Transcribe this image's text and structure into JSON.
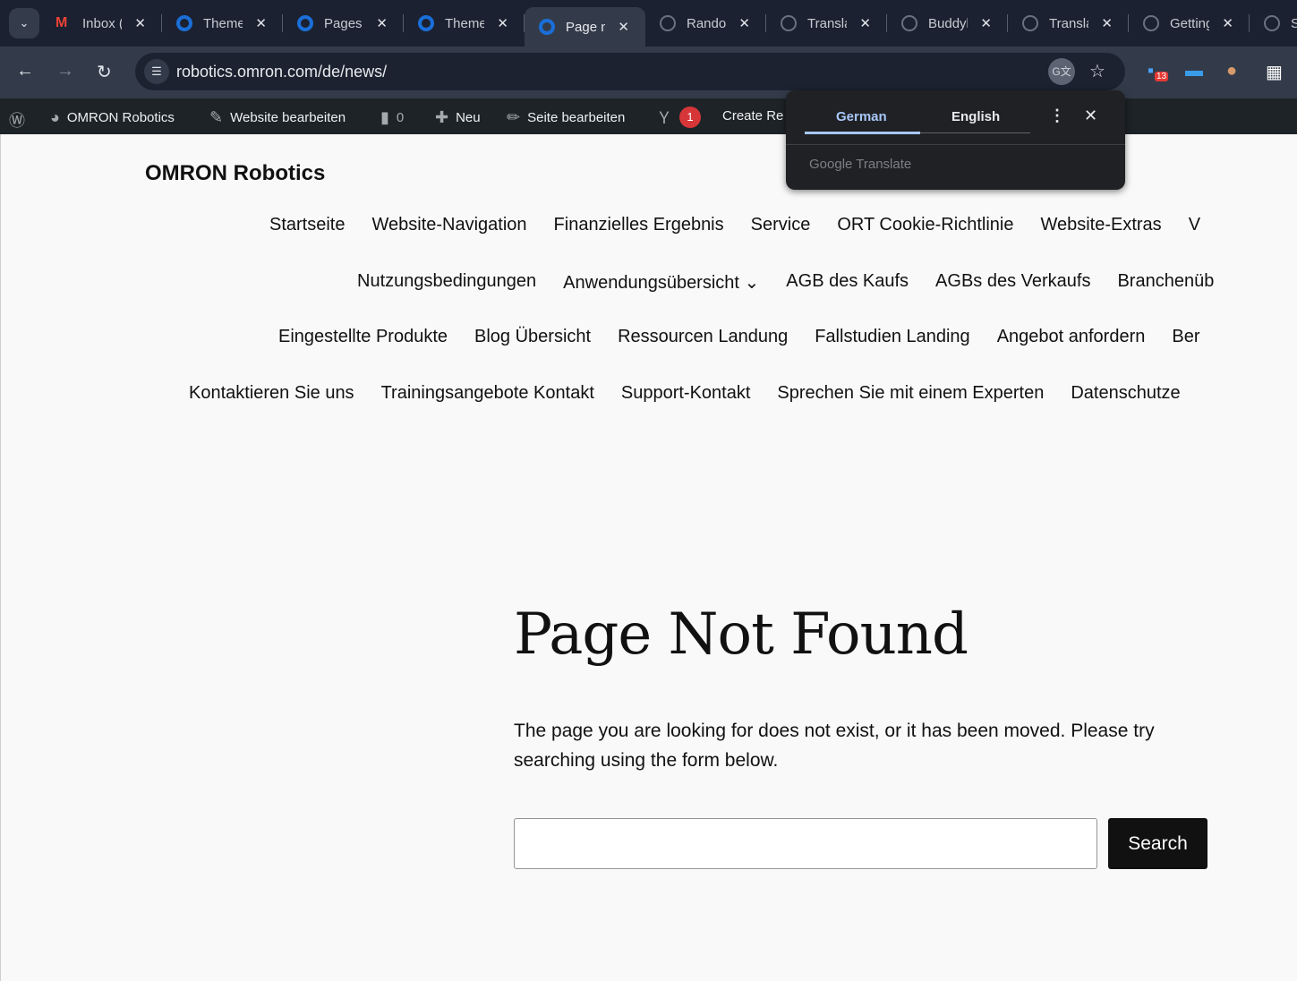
{
  "tabs": [
    {
      "title": "Inbox (",
      "icon": "gmail"
    },
    {
      "title": "Theme",
      "icon": "wp"
    },
    {
      "title": "Pages",
      "icon": "wp"
    },
    {
      "title": "Theme",
      "icon": "wp"
    },
    {
      "title": "Page n",
      "icon": "wp",
      "active": true
    },
    {
      "title": "Rando",
      "icon": "grey"
    },
    {
      "title": "Transla",
      "icon": "grey"
    },
    {
      "title": "Buddyl",
      "icon": "grey"
    },
    {
      "title": "Transla",
      "icon": "grey"
    },
    {
      "title": "Getting",
      "icon": "grey"
    },
    {
      "title": "Se",
      "icon": "grey"
    }
  ],
  "address": {
    "url": "robotics.omron.com/de/news/"
  },
  "extensions": {
    "badge_count": "13"
  },
  "admin_bar": {
    "site": "OMRON Robotics",
    "customize": "Website bearbeiten",
    "comments": "0",
    "new": "Neu",
    "edit": "Seite bearbeiten",
    "yoast_count": "1",
    "create": "Create Re"
  },
  "translate_popup": {
    "tab_from": "German",
    "tab_to": "English",
    "brand": "Google Translate"
  },
  "site_title": "OMRON Robotics",
  "nav_rows": [
    [
      "Startseite",
      "Website-Navigation",
      "Finanzielles Ergebnis",
      "Service",
      "ORT Cookie-Richtlinie",
      "Website-Extras",
      "V"
    ],
    [
      "Nutzungsbedingungen",
      "Anwendungsübersicht ⌄",
      "AGB des Kaufs",
      "AGBs des Verkaufs",
      "Branchenüb"
    ],
    [
      "Eingestellte Produkte",
      "Blog Übersicht",
      "Ressourcen Landung",
      "Fallstudien Landing",
      "Angebot anfordern",
      "Ber"
    ],
    [
      "Kontaktieren Sie uns",
      "Trainingsangebote Kontakt",
      "Support-Kontakt",
      "Sprechen Sie mit einem Experten",
      "Datenschutze"
    ]
  ],
  "main": {
    "heading": "Page Not Found",
    "message": "The page you are looking for does not exist, or it has been moved. Please try searching using the form below.",
    "search_value": "",
    "search_button": "Search"
  }
}
